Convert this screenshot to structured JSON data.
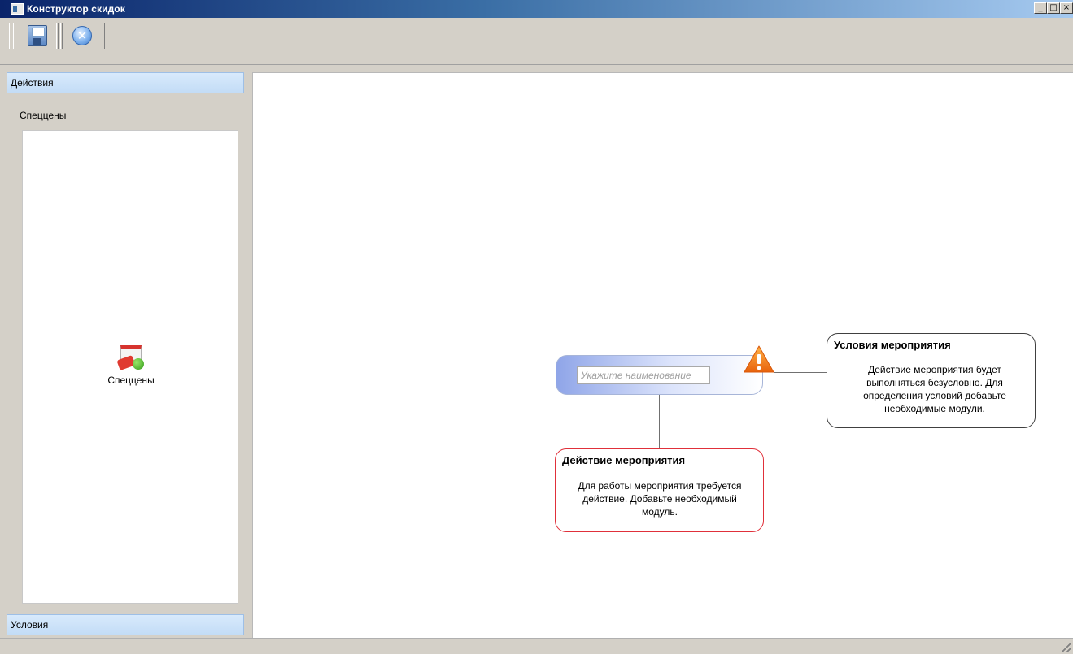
{
  "window": {
    "title": "Конструктор скидок",
    "buttons": [
      "_",
      "□",
      "×"
    ]
  },
  "toolbar": {
    "buttons": [
      {
        "name": "save",
        "icon": "floppy-disk-icon"
      },
      {
        "name": "cancel",
        "icon": "cancel-circle-icon"
      }
    ]
  },
  "sidebar": {
    "actions_header": "Действия",
    "group_label": "Спеццены",
    "items": [
      {
        "label": "Спеццены",
        "icon": "special-price-icon"
      }
    ],
    "conditions_header": "Условия"
  },
  "canvas": {
    "node": {
      "name_placeholder": "Укажите наименование",
      "warning_icon": "warning-triangle-icon"
    },
    "conditions_callout": {
      "title": "Условия мероприятия",
      "lines": [
        "Действие мероприятия будет",
        "выполняться безусловно. Для",
        "определения условий добавьте",
        "необходимые модули."
      ]
    },
    "action_callout": {
      "title": "Действие мероприятия",
      "lines": [
        "Для работы мероприятия требуется",
        "действие. Добавьте необходимый",
        "модуль."
      ]
    }
  },
  "colors": {
    "title_bar_start": "#0a246a",
    "title_bar_end": "#a6caf0",
    "section_header": "#c3dcf6",
    "warning": "#f08a1e",
    "action_callout_border": "#e0303a"
  }
}
